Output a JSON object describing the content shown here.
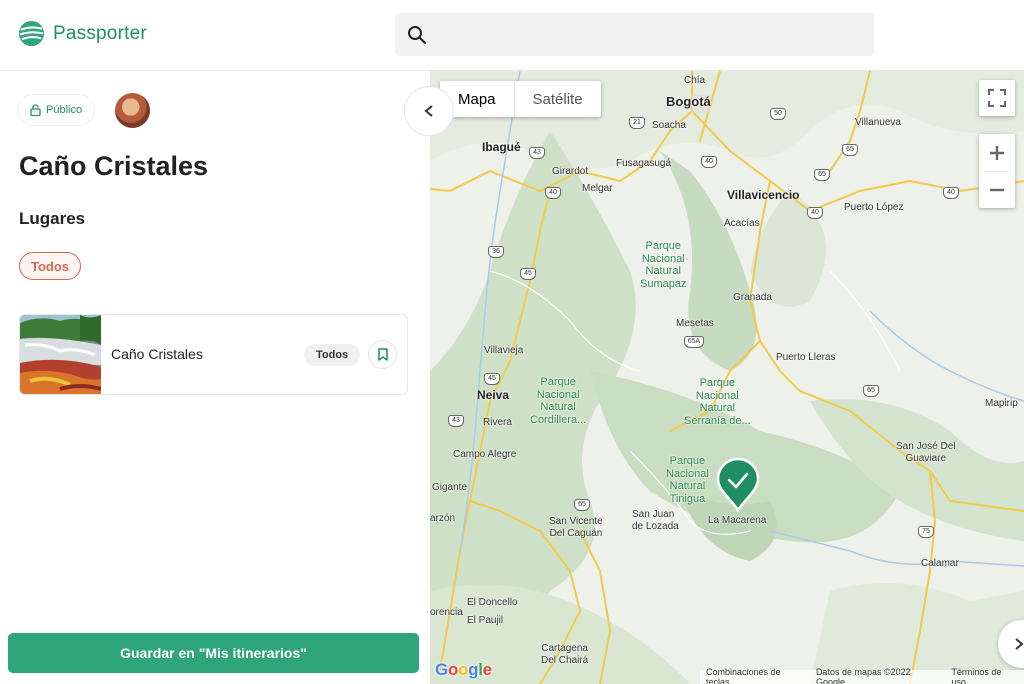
{
  "header": {
    "brand": "Passporter",
    "search_icon": "search-icon",
    "search_placeholder": ""
  },
  "sidebar": {
    "visibility_label": "Público",
    "title": "Caño Cristales",
    "section_title": "Lugares",
    "filter_chip": "Todos",
    "places": [
      {
        "name": "Caño Cristales",
        "tag": "Todos"
      }
    ],
    "save_button": "Guardar en \"Mis itinerarios\""
  },
  "map": {
    "type_map": "Mapa",
    "type_satellite": "Satélite",
    "labels": {
      "chia": "Chía",
      "bogota": "Bogotá",
      "soacha": "Soacha",
      "ibague": "Ibagué",
      "girardot": "Girardot",
      "fusagasuga": "Fusagasugá",
      "melgar": "Melgar",
      "villavicencio": "Villavicencio",
      "acacias": "Acacías",
      "villanueva": "Villanueva",
      "puerto_lopez": "Puerto López",
      "sumapaz": "Parque\nNacional\nNatural\nSumapaz",
      "granada": "Granada",
      "mesetas": "Mesetas",
      "villavieja": "Villavieja",
      "puerto_lleras": "Puerto Lleras",
      "cordillera": "Parque\nNacional\nNatural\nCordillera...",
      "serrania": "Parque\nNacional\nNatural\nSerranía de...",
      "neiva": "Neiva",
      "rivera": "Rivera",
      "campo_alegre": "Campo Alegre",
      "tinigua": "Parque\nNacional\nNatural\nTinigua",
      "san_jose": "San José Del\nGuaviare",
      "mapiripan": "Mapirip",
      "gigante": "Gigante",
      "garzon": "arzón",
      "san_vicente": "San Vicente\nDel Caguán",
      "san_juan": "San Juan\nde Lozada",
      "la_macarena": "La Macarena",
      "calamar": "Calamar",
      "el_doncello": "El Doncello",
      "el_paujil": "El Paujil",
      "florencia": "orencia",
      "cartagena": "Cartagena\nDel Chairá"
    },
    "shields": {
      "s21": "21",
      "s43a": "43",
      "s40a": "40",
      "s40b": "40",
      "s50": "50",
      "s65a": "65",
      "s40c": "40",
      "s40d": "40",
      "s36": "36",
      "s45a": "45",
      "s65b": "65",
      "s65c": "65A",
      "s45b": "45",
      "s43b": "43",
      "s65d": "65",
      "s75": "75",
      "s65e": "65"
    },
    "attribution": {
      "shortcuts": "Combinaciones de teclas",
      "data": "Datos de mapas ©2022 Google",
      "terms": "Términos de uso"
    },
    "logo_text": [
      "G",
      "o",
      "o",
      "g",
      "l",
      "e"
    ],
    "colors": {
      "brand_green": "#1f8f63",
      "marker_green": "#1f8f63",
      "filter_red": "#d06a56"
    }
  }
}
